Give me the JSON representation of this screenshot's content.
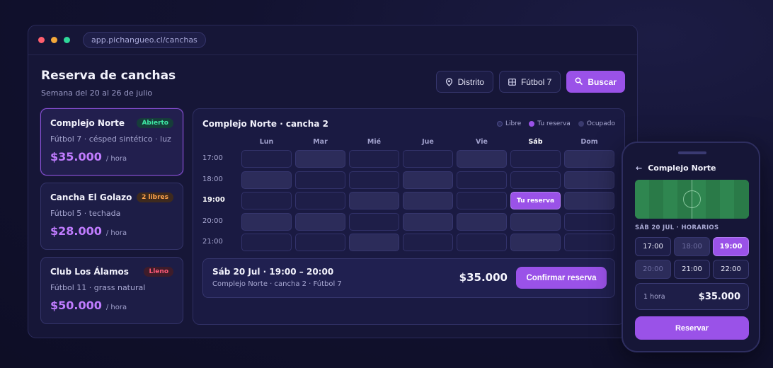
{
  "browser": {
    "url": "app.pichangueo.cl/canchas",
    "traffic_lights": [
      "#ff5f6e",
      "#f4a83a",
      "#2fd89a"
    ]
  },
  "page": {
    "title": "Reserva de canchas",
    "subtitle": "Semana del 20 al 26 de julio"
  },
  "filters": {
    "district_label": "Distrito",
    "type_label": "Fútbol 7",
    "search_label": "Buscar"
  },
  "venues": [
    {
      "name": "Complejo Norte",
      "badge": "Abierto",
      "badge_color": "green",
      "desc": "Fútbol 7 · césped sintético · luz",
      "price": "$35.000",
      "per": "/ hora",
      "active": true
    },
    {
      "name": "Cancha El Golazo",
      "badge": "2 libres",
      "badge_color": "orange",
      "desc": "Fútbol 5 · techada",
      "price": "$28.000",
      "per": "/ hora",
      "active": false
    },
    {
      "name": "Club Los Álamos",
      "badge": "Lleno",
      "badge_color": "red",
      "desc": "Fútbol 11 · grass natural",
      "price": "$50.000",
      "per": "/ hora",
      "active": false
    }
  ],
  "schedule": {
    "title": "Complejo Norte · cancha 2",
    "legend": [
      {
        "label": "Libre",
        "color": "#2a2a5c"
      },
      {
        "label": "Tu reserva",
        "color": "#9a52e8"
      },
      {
        "label": "Ocupado",
        "color": "#3a3a6e"
      }
    ],
    "days": [
      "Lun",
      "Mar",
      "Mié",
      "Jue",
      "Vie",
      "Sáb",
      "Dom"
    ],
    "highlight_day": 5,
    "times": [
      "17:00",
      "18:00",
      "19:00",
      "20:00",
      "21:00"
    ],
    "highlight_time": 2,
    "grid": [
      [
        "free",
        "busy",
        "free",
        "free",
        "busy",
        "free",
        "busy"
      ],
      [
        "busy",
        "free",
        "free",
        "busy",
        "free",
        "free",
        "busy"
      ],
      [
        "free",
        "free",
        "busy",
        "busy",
        "free",
        "mine",
        "busy"
      ],
      [
        "busy",
        "busy",
        "free",
        "busy",
        "busy",
        "busy",
        "free"
      ],
      [
        "free",
        "free",
        "busy",
        "free",
        "free",
        "busy",
        "free"
      ]
    ],
    "mine_label": "Tu reserva"
  },
  "confirm": {
    "title": "Sáb 20 Jul · 19:00 – 20:00",
    "subtitle": "Complejo Norte · cancha 2 · Fútbol 7",
    "price": "$35.000",
    "button": "Confirmar reserva"
  },
  "phone": {
    "title": "Complejo Norte",
    "section": "SÁB 20 JUL · HORARIOS",
    "slots": [
      {
        "time": "17:00",
        "state": "free"
      },
      {
        "time": "18:00",
        "state": "busy"
      },
      {
        "time": "19:00",
        "state": "sel"
      },
      {
        "time": "20:00",
        "state": "busy"
      },
      {
        "time": "21:00",
        "state": "free"
      },
      {
        "time": "22:00",
        "state": "free"
      }
    ],
    "duration": "1 hora",
    "total": "$35.000",
    "button": "Reservar"
  }
}
